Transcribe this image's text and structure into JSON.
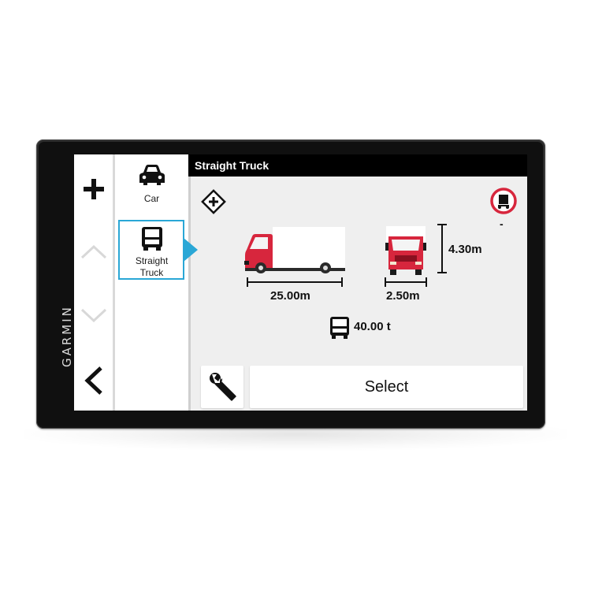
{
  "device": {
    "brand": "GARMIN"
  },
  "screen": {
    "title": "Straight Truck",
    "modes": [
      {
        "label": "Car",
        "icon": "car-icon",
        "selected": false
      },
      {
        "label": "Straight\nTruck",
        "icon": "truck-icon",
        "selected": true
      }
    ],
    "nav": {
      "add_icon": "plus-icon",
      "up_icon": "chevron-up-icon",
      "down_icon": "chevron-down-icon",
      "back_icon": "back-arrow-icon"
    },
    "dimensions": {
      "length": "25.00m",
      "width": "2.50m",
      "height": "4.30m",
      "weight": "40.00 t"
    },
    "hazmat_indicator": "-",
    "select_label": "Select",
    "settings_icon": "wrench-icon",
    "colors": {
      "accent": "#2aa7d6",
      "truck": "#d7263d",
      "header": "#000000"
    }
  }
}
